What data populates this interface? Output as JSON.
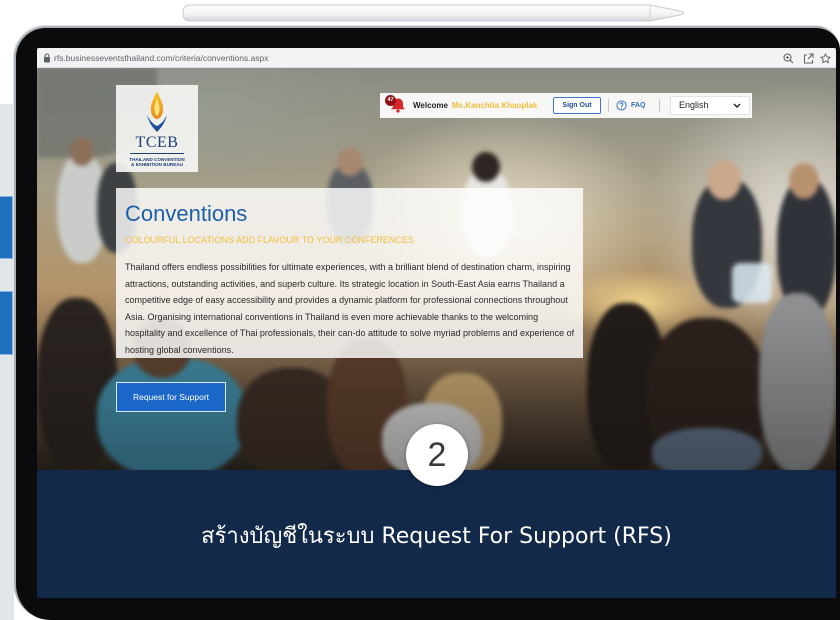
{
  "browser": {
    "url": "rfs.businesseventsthailand.com/criteria/conventions.aspx"
  },
  "logo": {
    "acronym": "TCEB",
    "line1": "THAILAND CONVENTION",
    "line2": "& EXHIBITION BUREAU"
  },
  "header": {
    "notification_count": "47",
    "welcome_label": "Welcome",
    "user_name": "Ms.Kanchita Khaoplak",
    "sign_out_label": "Sign Out",
    "faq_label": "FAQ",
    "language_selected": "English"
  },
  "hero": {
    "title": "Conventions",
    "subtitle": "COLOURFUL LOCATIONS ADD FLAVOUR TO YOUR CONFERENCES",
    "body": "Thailand offers endless possibilities for ultimate experiences, with a brilliant blend of destination charm, inspiring attractions, outstanding activities, and superb culture. Its strategic location in South-East Asia earns Thailand a competitive edge of easy accessibility and provides a dynamic platform for professional connections throughout Asia. Organising international conventions in Thailand is even more achievable thanks to the welcoming hospitality and excellence of Thai professionals, their can-do attitude to solve myriad problems and experience of hosting global conventions."
  },
  "actions": {
    "request_support_label": "Request for Support"
  },
  "tutorial": {
    "step_number": "2",
    "caption": "สร้างบัญชีในระบบ Request For Support (RFS)"
  },
  "icons": {
    "address_bar": "lock-icon",
    "browser_actions": [
      "zoom-icon",
      "share-icon",
      "star-icon"
    ],
    "notification": "bell-icon",
    "faq": "question-circle-icon",
    "language_dropdown": "chevron-down-icon",
    "logo": "tceb-flame-logo"
  },
  "colors": {
    "brand_blue": "#1b5fa8",
    "highlight_yellow": "#f2bd3a",
    "button_blue": "#1a66c9",
    "panel_navy": "#13294a",
    "badge_red": "#8f1114"
  }
}
